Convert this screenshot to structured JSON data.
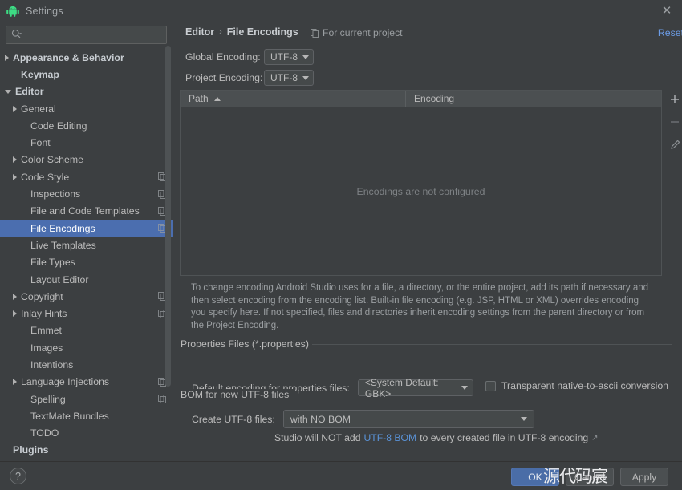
{
  "window": {
    "title": "Settings",
    "app_icon": "android-robot-icon",
    "close_icon": "close-icon"
  },
  "sidebar": {
    "search": {
      "placeholder": "",
      "value": "",
      "icon": "search-icon"
    },
    "items": [
      {
        "label": "Appearance & Behavior",
        "indent": 0,
        "twisty": "right",
        "bold": true,
        "badge": false,
        "selected": false
      },
      {
        "label": "Keymap",
        "indent": 1,
        "twisty": "none",
        "bold": true,
        "badge": false,
        "selected": false
      },
      {
        "label": "Editor",
        "indent": 0,
        "twisty": "down",
        "bold": true,
        "badge": false,
        "selected": false
      },
      {
        "label": "General",
        "indent": 1,
        "twisty": "right",
        "bold": false,
        "badge": false,
        "selected": false
      },
      {
        "label": "Code Editing",
        "indent": 2,
        "twisty": "none",
        "bold": false,
        "badge": false,
        "selected": false
      },
      {
        "label": "Font",
        "indent": 2,
        "twisty": "none",
        "bold": false,
        "badge": false,
        "selected": false
      },
      {
        "label": "Color Scheme",
        "indent": 1,
        "twisty": "right",
        "bold": false,
        "badge": false,
        "selected": false
      },
      {
        "label": "Code Style",
        "indent": 1,
        "twisty": "right",
        "bold": false,
        "badge": true,
        "selected": false
      },
      {
        "label": "Inspections",
        "indent": 2,
        "twisty": "none",
        "bold": false,
        "badge": true,
        "selected": false
      },
      {
        "label": "File and Code Templates",
        "indent": 2,
        "twisty": "none",
        "bold": false,
        "badge": true,
        "selected": false
      },
      {
        "label": "File Encodings",
        "indent": 2,
        "twisty": "none",
        "bold": false,
        "badge": true,
        "selected": true
      },
      {
        "label": "Live Templates",
        "indent": 2,
        "twisty": "none",
        "bold": false,
        "badge": false,
        "selected": false
      },
      {
        "label": "File Types",
        "indent": 2,
        "twisty": "none",
        "bold": false,
        "badge": false,
        "selected": false
      },
      {
        "label": "Layout Editor",
        "indent": 2,
        "twisty": "none",
        "bold": false,
        "badge": false,
        "selected": false
      },
      {
        "label": "Copyright",
        "indent": 1,
        "twisty": "right",
        "bold": false,
        "badge": true,
        "selected": false
      },
      {
        "label": "Inlay Hints",
        "indent": 1,
        "twisty": "right",
        "bold": false,
        "badge": true,
        "selected": false
      },
      {
        "label": "Emmet",
        "indent": 2,
        "twisty": "none",
        "bold": false,
        "badge": false,
        "selected": false
      },
      {
        "label": "Images",
        "indent": 2,
        "twisty": "none",
        "bold": false,
        "badge": false,
        "selected": false
      },
      {
        "label": "Intentions",
        "indent": 2,
        "twisty": "none",
        "bold": false,
        "badge": false,
        "selected": false
      },
      {
        "label": "Language Injections",
        "indent": 1,
        "twisty": "right",
        "bold": false,
        "badge": true,
        "selected": false
      },
      {
        "label": "Spelling",
        "indent": 2,
        "twisty": "none",
        "bold": false,
        "badge": true,
        "selected": false
      },
      {
        "label": "TextMate Bundles",
        "indent": 2,
        "twisty": "none",
        "bold": false,
        "badge": false,
        "selected": false
      },
      {
        "label": "TODO",
        "indent": 2,
        "twisty": "none",
        "bold": false,
        "badge": false,
        "selected": false
      },
      {
        "label": "Plugins",
        "indent": 0,
        "twisty": "none",
        "bold": true,
        "badge": false,
        "selected": false
      }
    ]
  },
  "main": {
    "breadcrumb": {
      "parent": "Editor",
      "separator": "›",
      "current": "File Encodings"
    },
    "for_current_project": {
      "label": "For current project",
      "icon": "copy-project-icon"
    },
    "reset_link": "Reset",
    "global_encoding": {
      "label": "Global Encoding:",
      "value": "UTF-8"
    },
    "project_encoding": {
      "label": "Project Encoding:",
      "value": "UTF-8"
    },
    "table": {
      "columns": [
        "Path",
        "Encoding"
      ],
      "sort_column": "Path",
      "sort_direction": "asc",
      "rows": [],
      "empty_message": "Encodings are not configured",
      "toolbar": [
        {
          "name": "add-row-button",
          "glyph": "+"
        },
        {
          "name": "remove-row-button",
          "glyph": "−"
        },
        {
          "name": "edit-row-button",
          "glyph": "pencil"
        }
      ]
    },
    "description": "To change encoding Android Studio uses for a file, a directory, or the entire project, add its path if necessary and then select encoding from the encoding list. Built-in file encoding (e.g. JSP, HTML or XML) overrides encoding you specify here. If not specified, files and directories inherit encoding settings from the parent directory or from the Project Encoding.",
    "properties_group": {
      "title": "Properties Files (*.properties)",
      "default_encoding_label": "Default encoding for properties files:",
      "default_encoding_value": "<System Default: GBK>",
      "transparent_label": "Transparent native-to-ascii conversion",
      "transparent_checked": false
    },
    "bom_group": {
      "title": "BOM for new UTF-8 files",
      "create_label": "Create UTF-8 files:",
      "create_value": "with NO BOM",
      "hint_prefix": "Studio will NOT add",
      "hint_link": "UTF-8 BOM",
      "hint_suffix": "to every created file in UTF-8 encoding",
      "external_arrow": "↗"
    }
  },
  "footer": {
    "help_label": "?",
    "ok_label": "OK",
    "cancel_label": "Cancel",
    "apply_label": "Apply",
    "watermark": "源代码宸"
  },
  "colors": {
    "background": "#3c3f41",
    "selection": "#4b6eaf",
    "link": "#5a93d8",
    "accent_button": "#4a6da7",
    "android_green": "#3ddc84"
  }
}
